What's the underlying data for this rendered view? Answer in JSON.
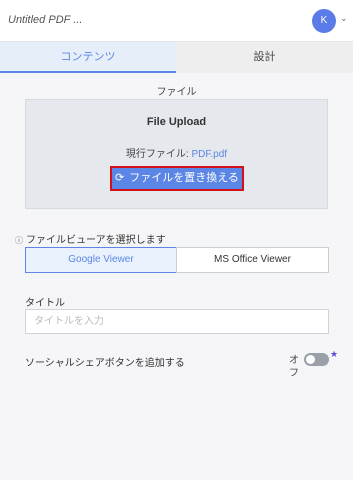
{
  "header": {
    "app_title": "Untitled PDF ...",
    "avatar_letter": "K",
    "chevron": "⌄"
  },
  "tabs": [
    {
      "label": "コンテンツ",
      "active": true
    },
    {
      "label": "設計",
      "active": false
    }
  ],
  "content": {
    "file_section_label": "ファイル",
    "upload": {
      "title": "File Upload",
      "current_file_label": "現行ファイル:",
      "current_file_name": "PDF.pdf",
      "replace_button_label": "ファイルを置き換える",
      "replace_icon": "refresh-icon"
    },
    "viewer": {
      "label": "ファイルビューアを選択します",
      "help_icon": "?",
      "options": [
        {
          "label": "Google Viewer",
          "selected": true
        },
        {
          "label": "MS Office Viewer",
          "selected": false
        }
      ]
    },
    "title_field": {
      "label": "タイトル",
      "placeholder": "タイトルを入力",
      "value": ""
    },
    "social_share": {
      "label": "ソーシャルシェアボタンを追加する",
      "toggle_state_text": "オフ",
      "enabled": false
    }
  },
  "colors": {
    "accent": "#5b86e5",
    "highlight_border": "#d3101a",
    "avatar_bg": "#5b7be8"
  }
}
